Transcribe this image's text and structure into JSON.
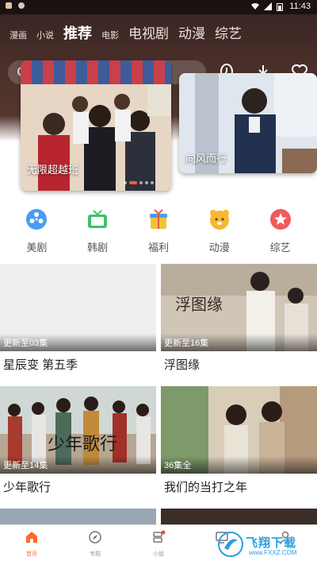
{
  "status_bar": {
    "time": "11:43"
  },
  "tabs": [
    {
      "label": "漫画",
      "size": "small"
    },
    {
      "label": "小说",
      "size": "small"
    },
    {
      "label": "推荐",
      "size": "active"
    },
    {
      "label": "电影",
      "size": "small"
    },
    {
      "label": "电视剧",
      "size": "big"
    },
    {
      "label": "动漫",
      "size": "big"
    },
    {
      "label": "综艺",
      "size": "big"
    }
  ],
  "top_icons": [
    "history-icon",
    "download-icon",
    "favorite-icon"
  ],
  "banners": [
    {
      "caption": "无限超越班"
    },
    {
      "caption": "向风而行"
    }
  ],
  "categories": [
    {
      "label": "美剧",
      "icon": "film-reel-icon",
      "color": "#4a9df0"
    },
    {
      "label": "韩剧",
      "icon": "tv-icon",
      "color": "#3cc26a"
    },
    {
      "label": "福利",
      "icon": "gift-icon",
      "color": "#f2c23a"
    },
    {
      "label": "动漫",
      "icon": "bear-icon",
      "color": "#f7b733"
    },
    {
      "label": "综艺",
      "icon": "star-icon",
      "color": "#f05a5a"
    }
  ],
  "cards": [
    {
      "title": "星辰变 第五季",
      "episode": "更新至03集"
    },
    {
      "title": "浮图缘",
      "episode": "更新至16集"
    },
    {
      "title": "少年歌行",
      "episode": "更新至14集"
    },
    {
      "title": "我们的当打之年",
      "episode": "36集全"
    }
  ],
  "bottom_nav": [
    {
      "label": "首页",
      "icon": "home-icon",
      "active": true
    },
    {
      "label": "专题",
      "icon": "compass-icon",
      "active": false
    },
    {
      "label": "小组",
      "icon": "group-icon",
      "active": false
    },
    {
      "label": "",
      "icon": "screen-icon",
      "active": false
    },
    {
      "label": "",
      "icon": "profile-icon",
      "active": false
    }
  ],
  "watermark": {
    "text": "飞翔下载",
    "sub": "www.FXXZ.COM"
  },
  "colors": {
    "accent": "#ff6a2a",
    "header_bg": "#4b302a"
  }
}
